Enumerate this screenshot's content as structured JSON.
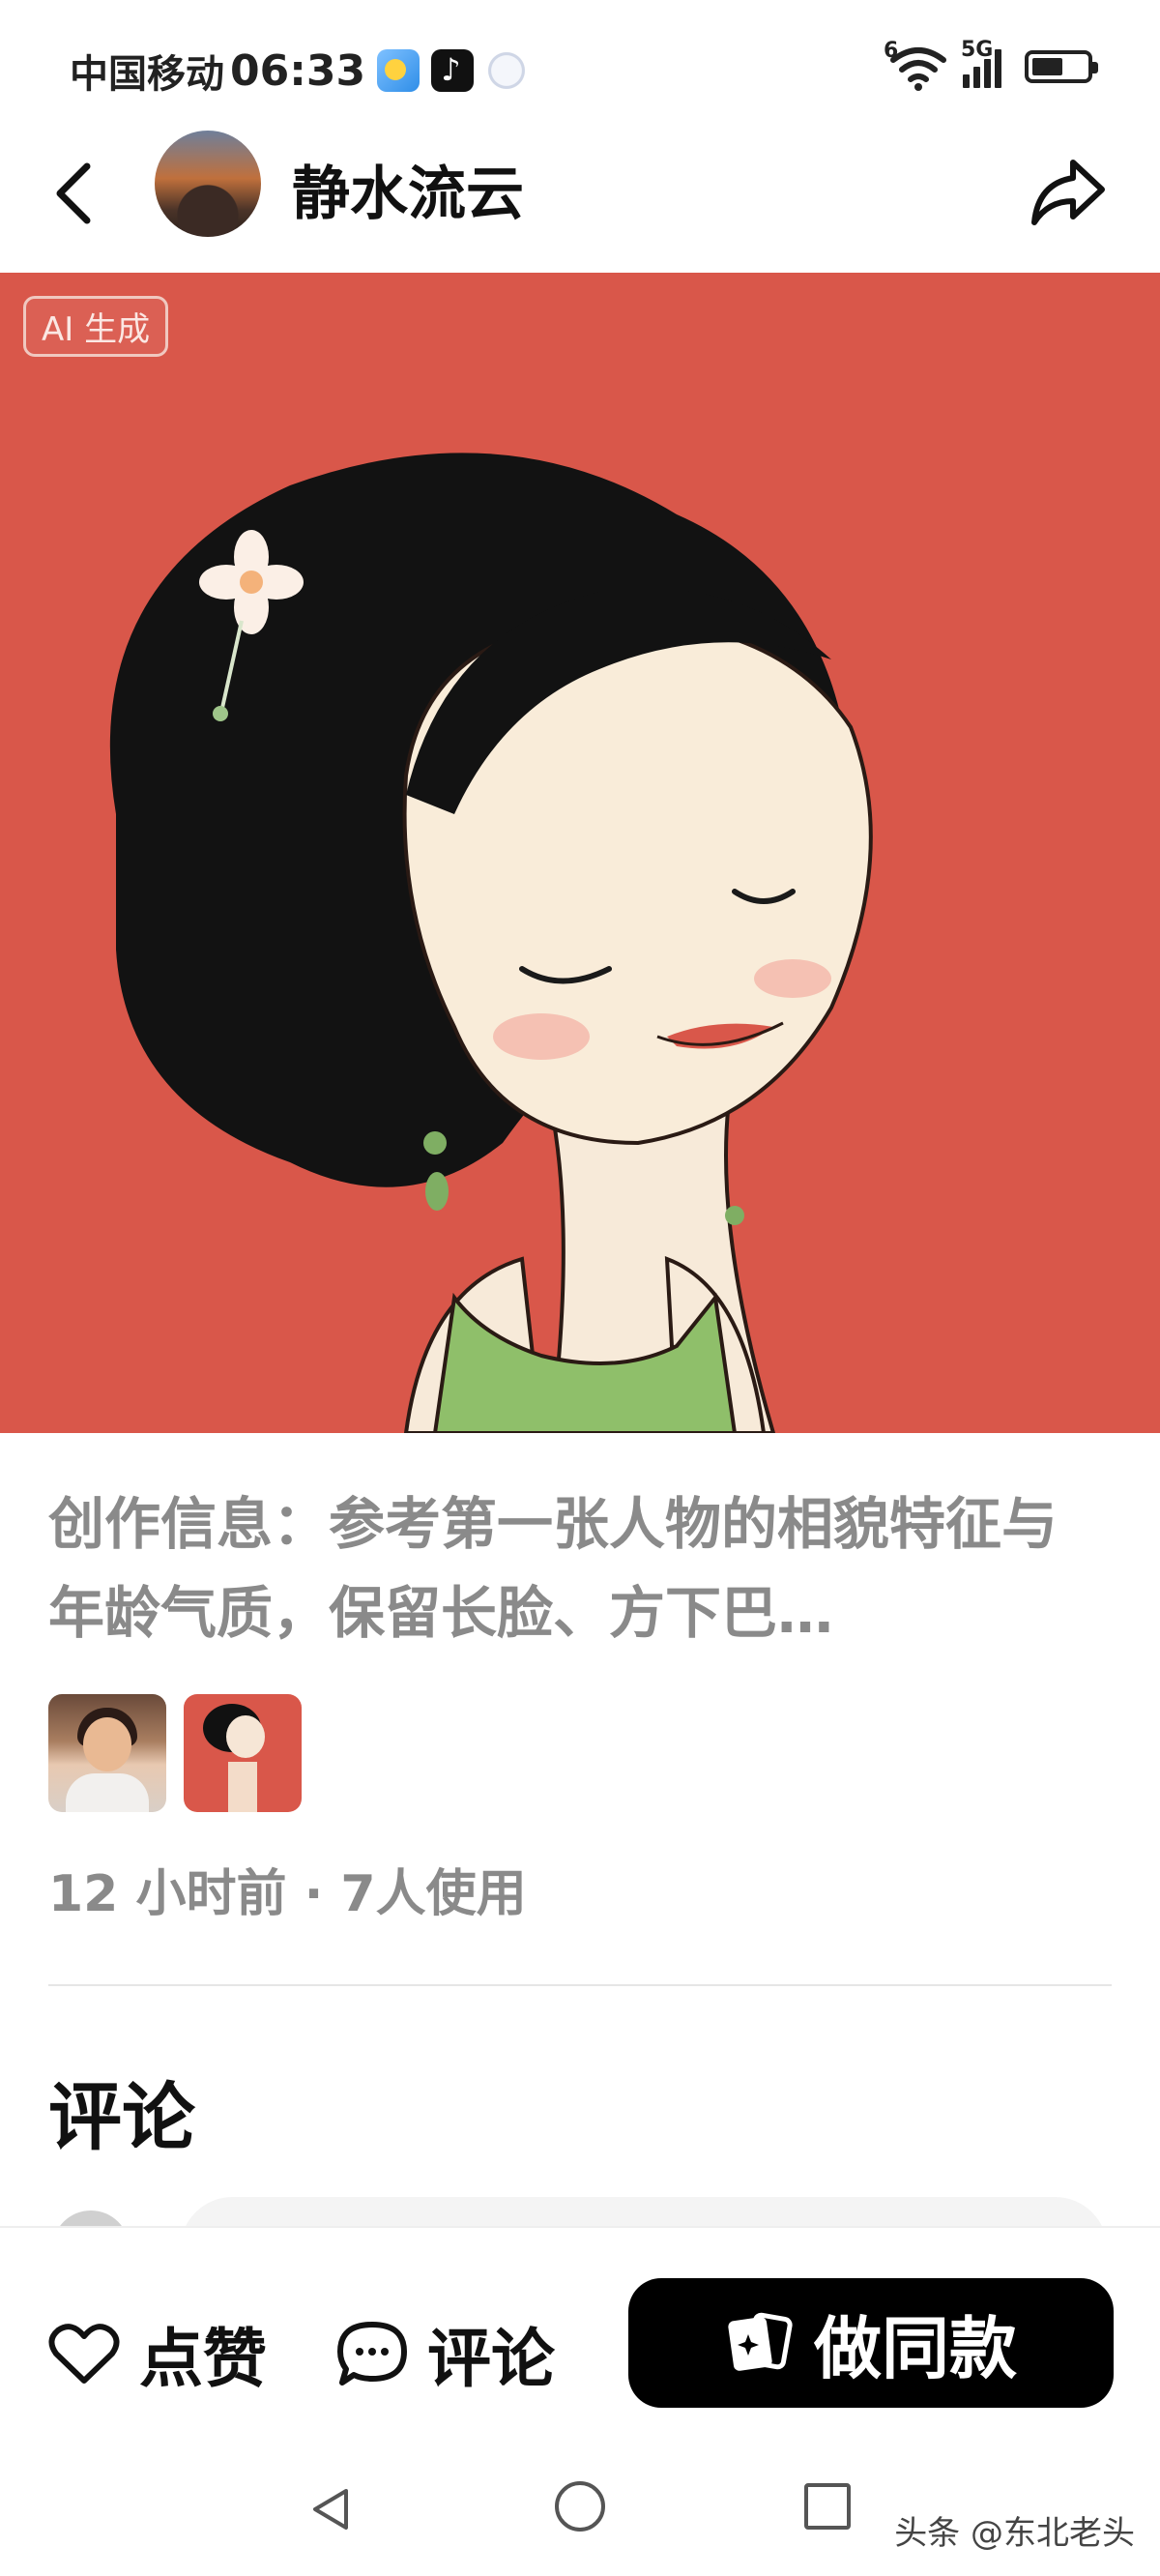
{
  "status_bar": {
    "carrier": "中国移动",
    "time": "06:33",
    "network": "5G",
    "wifi_badge": "6"
  },
  "header": {
    "author_name": "静水流云"
  },
  "artwork": {
    "badge": "AI 生成",
    "background_color": "#d9574a"
  },
  "post": {
    "description": "创作信息：参考第一张人物的相貌特征与年龄气质，保留长脸、方下巴…",
    "meta": "12 小时前 · 7人使用"
  },
  "comments": {
    "title": "评论"
  },
  "actions": {
    "like_label": "点赞",
    "comment_label": "评论",
    "make_same_label": "做同款"
  },
  "footer": {
    "watermark": "头条 @东北老头"
  }
}
